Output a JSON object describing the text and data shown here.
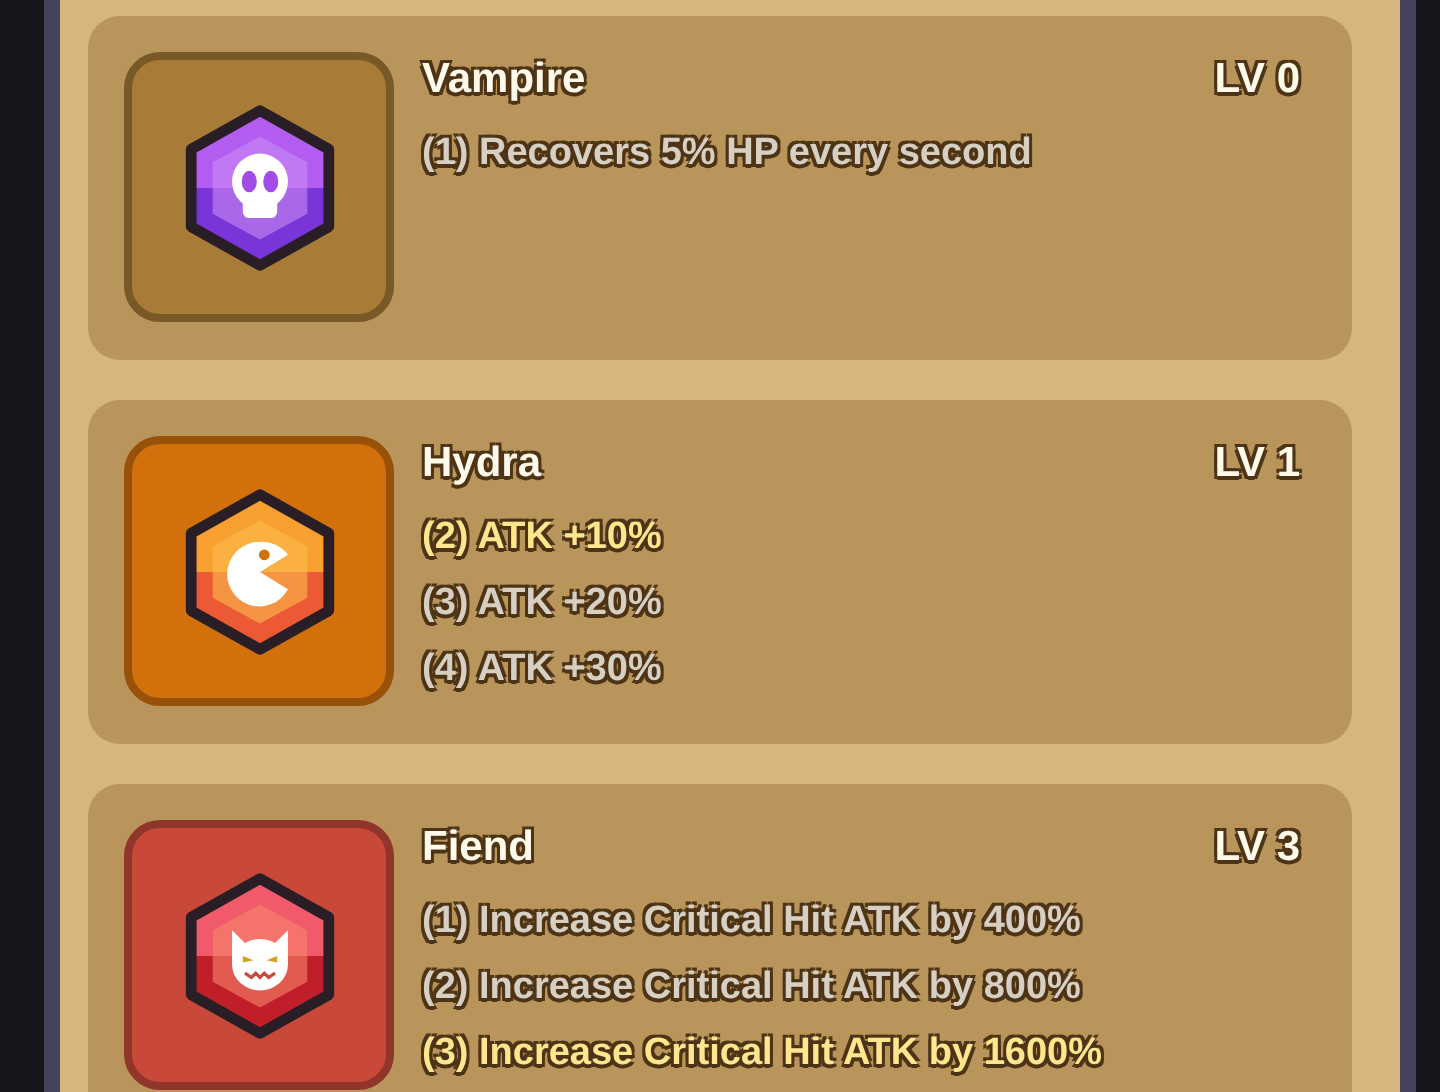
{
  "skills": [
    {
      "name": "Vampire",
      "level_label": "LV 0",
      "kind": "skull",
      "color": "#a87b36",
      "effects": [
        {
          "text": "(1) Recovers 5% HP every second",
          "active": false
        }
      ]
    },
    {
      "name": "Hydra",
      "level_label": "LV 1",
      "kind": "chomper",
      "color": "#d2700c",
      "effects": [
        {
          "text": "(2) ATK +10%",
          "active": true
        },
        {
          "text": "(3) ATK +20%",
          "active": false
        },
        {
          "text": "(4) ATK +30%",
          "active": false
        }
      ]
    },
    {
      "name": "Fiend",
      "level_label": "LV 3",
      "kind": "cat",
      "color": "#c8493a",
      "effects": [
        {
          "text": "(1) Increase Critical Hit ATK by 400%",
          "active": false
        },
        {
          "text": "(2) Increase Critical Hit ATK by 800%",
          "active": false
        },
        {
          "text": "(3) Increase Critical Hit ATK by 1600%",
          "active": true
        }
      ]
    }
  ]
}
